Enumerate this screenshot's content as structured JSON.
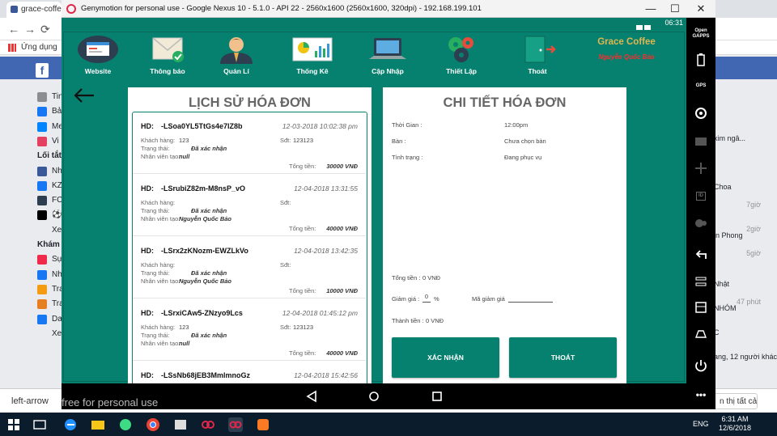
{
  "browser": {
    "tab_title": "grace-coffe",
    "bookmark_label": "Ứng dụng",
    "left_items": [
      "Tin",
      "Bả",
      "Me",
      "Vi",
      "Lối tắt",
      "Nh",
      "KZ",
      "FC",
      "⚽",
      "Xe",
      "Khám",
      "Sự",
      "Nh",
      "Tra",
      "Tra",
      "Da",
      "Xe"
    ],
    "right_items": [
      {
        "text": "kim ngâ...",
        "time": ""
      },
      {
        "text": "",
        "time": "7giờ"
      },
      {
        "text": "Choa",
        "time": "2giờ"
      },
      {
        "text": "",
        "time": "5giờ"
      },
      {
        "text": "in Phong",
        "time": ""
      },
      {
        "text": "",
        "time": "47 phút"
      },
      {
        "text": "Nhật",
        "time": ""
      },
      {
        "text": "NHÓM",
        "time": ""
      },
      {
        "text": "C",
        "time": ""
      },
      {
        "text": "ang, 12 người khác",
        "time": ""
      }
    ],
    "download_item": "left-arrow",
    "download_button": "n thị tất cả"
  },
  "genymotion": {
    "title": "Genymotion for personal use - Google Nexus 10 - 5.1.0 - API 22 - 2560x1600 (2560x1600, 320dpi) - 192.168.199.101",
    "watermark": "free for personal use",
    "side_labels": [
      "Open GAPPS",
      "GPS",
      "ID"
    ]
  },
  "statusbar": {
    "time": "06:31"
  },
  "nav": [
    {
      "label": "Website",
      "icon": "website-icon"
    },
    {
      "label": "Thông báo",
      "icon": "mail-icon"
    },
    {
      "label": "Quản Lí",
      "icon": "manager-icon"
    },
    {
      "label": "Thống Kê",
      "icon": "stats-icon"
    },
    {
      "label": "Cập Nhập",
      "icon": "laptop-icon"
    },
    {
      "label": "Thiết Lập",
      "icon": "gears-icon"
    },
    {
      "label": "Thoát",
      "icon": "exit-door-icon"
    }
  ],
  "brand": {
    "name": "Grace Coffee",
    "owner": "Nguyễn Quốc Bảo"
  },
  "history": {
    "title": "LỊCH SỬ HÓA ĐƠN",
    "labels": {
      "hd": "HD:",
      "customer": "Khách hàng:",
      "status": "Trạng thái:",
      "staff": "Nhân viên tạo:",
      "phone": "Sđt:",
      "total": "Tổng tiền:"
    },
    "invoices": [
      {
        "code": "-LSoa0YL5TtGs4e7lZ8b",
        "date": "12-03-2018 10:02:38 pm",
        "customer": "123",
        "phone": "123123",
        "status": "Đã xác nhận",
        "staff": "null",
        "total": "30000 VNĐ"
      },
      {
        "code": "-LSrubiZ82m-M8nsP_vO",
        "date": "12-04-2018 13:31:55",
        "customer": "",
        "phone": "",
        "status": "Đã xác nhận",
        "staff": "Nguyễn Quốc Bảo",
        "total": "40000 VNĐ"
      },
      {
        "code": "-LSrx2zKNozm-EWZLkVo",
        "date": "12-04-2018 13:42:35",
        "customer": "",
        "phone": "",
        "status": "Đã xác nhận",
        "staff": "Nguyễn Quốc Bảo",
        "total": "10000 VNĐ"
      },
      {
        "code": "-LSrxiCAw5-ZNzyo9Lcs",
        "date": "12-04-2018 01:45:12 pm",
        "customer": "123",
        "phone": "123123",
        "status": "Đã xác nhận",
        "staff": "null",
        "total": "40000 VNĐ"
      },
      {
        "code": "-LSsNb68jEB3MmlmnoGz",
        "date": "12-04-2018 15:42:56",
        "customer": "",
        "phone": "",
        "status": "",
        "staff": "",
        "total": ""
      }
    ]
  },
  "detail": {
    "title": "CHI TIẾT HÓA ĐƠN",
    "time_label": "Thời Gian :",
    "time_value": "12:00pm",
    "table_label": "Bàn :",
    "table_value": "Chưa chọn bàn",
    "status_label": "Tình trạng :",
    "status_value": "Đang phục vụ",
    "total_label": "Tổng tiền :",
    "total_value": "0 VNĐ",
    "discount_label": "Giảm giá :",
    "discount_value": "0",
    "discount_unit": "%",
    "code_label": "Mã giảm giá",
    "pay_label": "Thành tiền :",
    "pay_value": "0 VNĐ",
    "confirm_button": "XÁC NHẬN",
    "exit_button": "THOÁT"
  },
  "taskbar": {
    "lang": "ENG",
    "time": "6:31 AM",
    "date": "12/6/2018"
  }
}
